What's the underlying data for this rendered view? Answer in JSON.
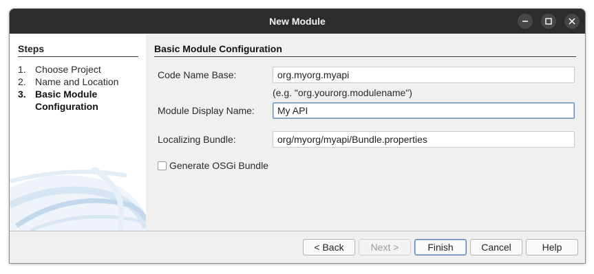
{
  "window": {
    "title": "New Module"
  },
  "steps": {
    "heading": "Steps",
    "items": [
      {
        "num": "1.",
        "label": "Choose Project"
      },
      {
        "num": "2.",
        "label": "Name and Location"
      },
      {
        "num": "3.",
        "label": "Basic Module",
        "label_cont": "Configuration",
        "current": true
      }
    ]
  },
  "form": {
    "heading": "Basic Module Configuration",
    "code_name_base": {
      "label": "Code Name Base:",
      "value": "org.myorg.myapi",
      "hint": "(e.g. \"org.yourorg.modulename\")"
    },
    "display_name": {
      "label": "Module Display Name:",
      "value": "My API"
    },
    "localizing_bundle": {
      "label": "Localizing Bundle:",
      "value": "org/myorg/myapi/Bundle.properties"
    },
    "osgi": {
      "label": "Generate OSGi Bundle",
      "checked": false
    }
  },
  "buttons": {
    "back": "< Back",
    "next": "Next >",
    "finish": "Finish",
    "cancel": "Cancel",
    "help": "Help"
  },
  "colors": {
    "titlebar": "#2c2c2c",
    "dialog_bg": "#f0f0f0",
    "focus": "#6f8fb8"
  }
}
